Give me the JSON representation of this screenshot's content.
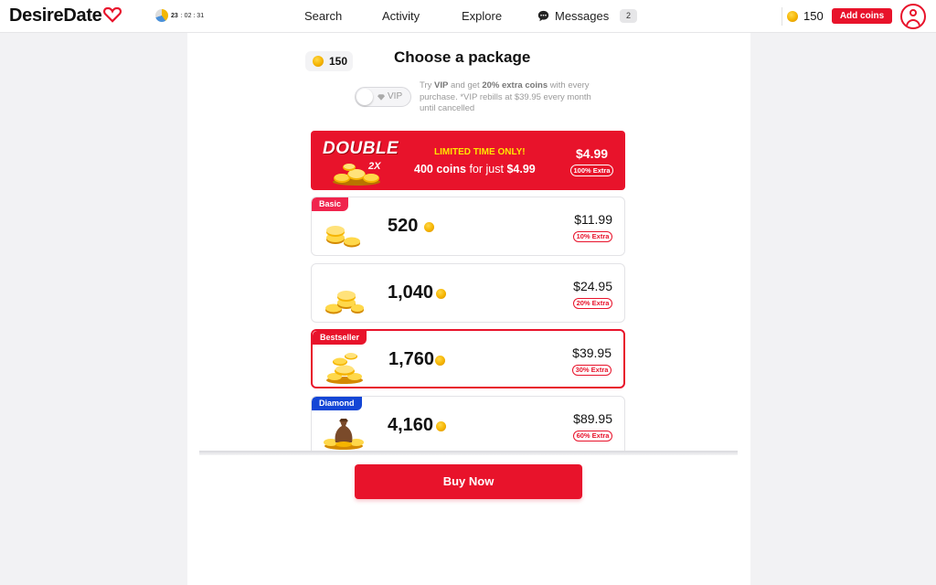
{
  "header": {
    "logo_text": "DesireDate",
    "logo_heart_icon": "heart-icon",
    "timer_hours": "23",
    "timer_rest": ": 02 : 31",
    "nav": {
      "search": "Search",
      "activity": "Activity",
      "explore": "Explore",
      "messages": "Messages",
      "messages_count": "2"
    },
    "coin_balance": "150",
    "add_coins_label": "Add coins"
  },
  "main": {
    "balance": "150",
    "title": "Choose a package",
    "vip_toggle_label": "VIP",
    "vip_toggle_on": false,
    "vip_info": {
      "pre": "Try ",
      "vip": "VIP",
      "mid": " and get ",
      "extra": "20% extra coins",
      "post": " with every purchase. *VIP rebills at $39.95 every month until cancelled"
    },
    "promo": {
      "badge_word": "DOUBLE",
      "badge_multiplier": "2X",
      "limited": "LIMITED TIME ONLY!",
      "offer_coins": "400 coins",
      "offer_mid": " for just ",
      "offer_price": "$4.99",
      "price": "$4.99",
      "extra": "100% Extra"
    },
    "packages": [
      {
        "tag": "Basic",
        "amount": "520",
        "price": "$11.99",
        "extra": "10% Extra"
      },
      {
        "tag": "",
        "amount": "1,040",
        "price": "$24.95",
        "extra": "20% Extra"
      },
      {
        "tag": "Bestseller",
        "amount": "1,760",
        "price": "$39.95",
        "extra": "30% Extra"
      },
      {
        "tag": "Diamond",
        "amount": "4,160",
        "price": "$89.95",
        "extra": "60% Extra"
      }
    ],
    "selected_package": "Bestseller",
    "buy_label": "Buy Now"
  },
  "colors": {
    "brand_red": "#e8132b",
    "diamond_blue": "#1446d6",
    "promo_yellow": "#ffe600"
  }
}
